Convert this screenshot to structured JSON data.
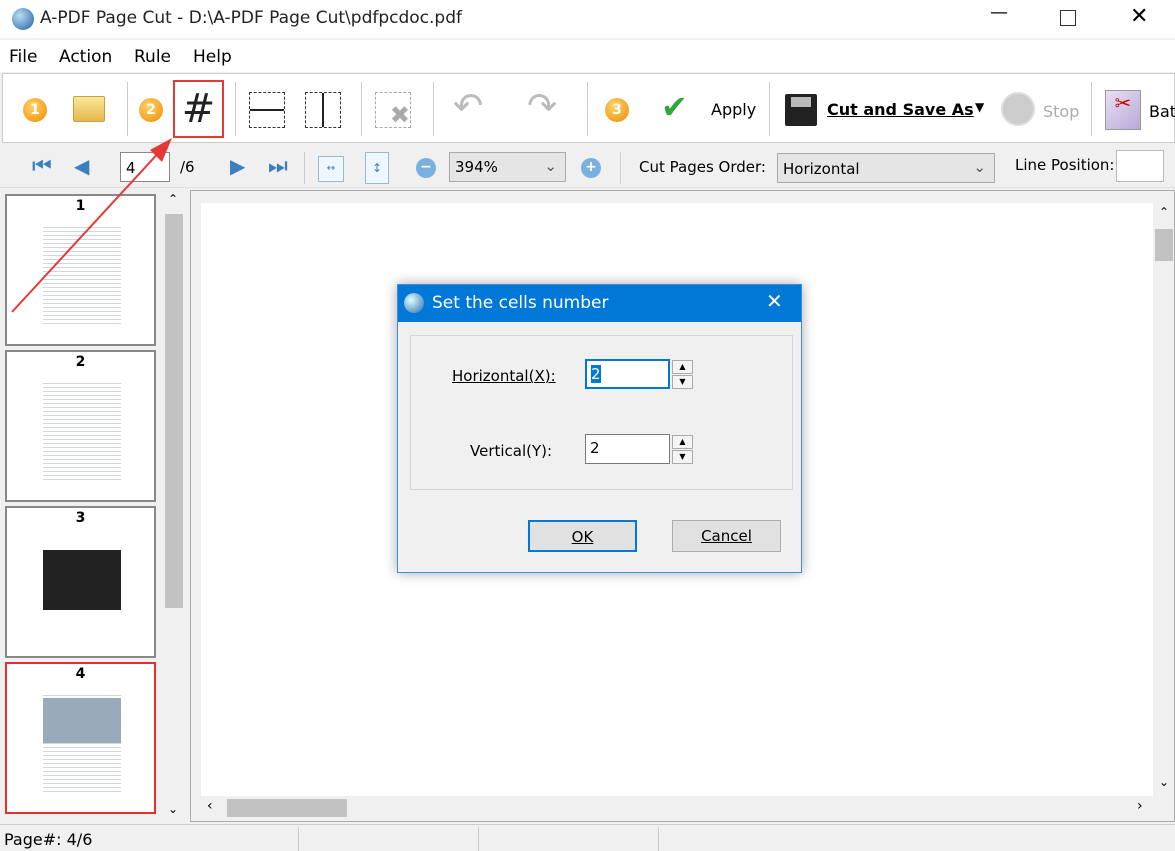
{
  "window": {
    "title": "A-PDF Page Cut - D:\\A-PDF Page Cut\\pdfpcdoc.pdf"
  },
  "menu": [
    "File",
    "Action",
    "Rule",
    "Help"
  ],
  "toolbar": {
    "step1": "1",
    "step2": "2",
    "step3": "3",
    "apply": "Apply",
    "cut_save": "Cut and Save As",
    "stop": "Stop",
    "batch": "Bat"
  },
  "nav": {
    "page": "4",
    "total": "/6",
    "zoom": "394%",
    "order_label": "Cut Pages Order:",
    "order_value": "Horizontal",
    "line_label": "Line Position:",
    "line_value": ""
  },
  "thumbs": [
    "1",
    "2",
    "3",
    "4"
  ],
  "dialog": {
    "title": "Set the cells number",
    "h_label": "Horizontal(X):",
    "h_value": "2",
    "v_label": "Vertical(Y):",
    "v_value": "2",
    "ok": "OK",
    "cancel": "Cancel"
  },
  "status": {
    "page": "Page#: 4/6"
  },
  "colors": {
    "accent": "#0078d7",
    "highlight": "#e53935"
  }
}
